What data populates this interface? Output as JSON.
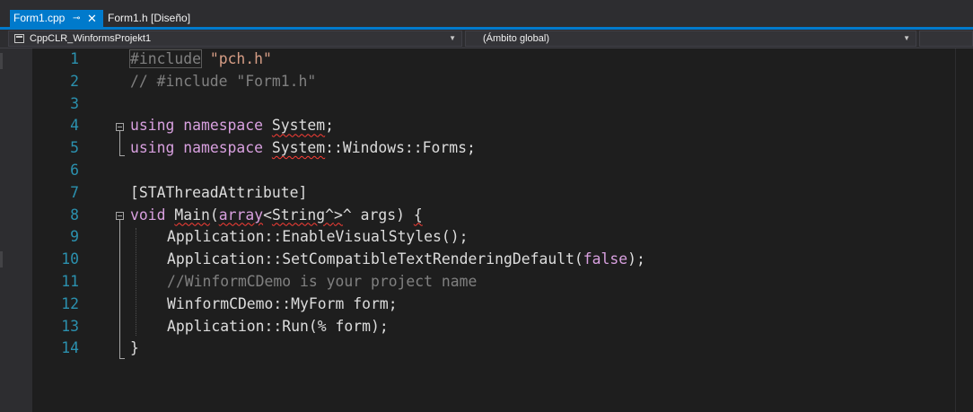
{
  "tabs": [
    {
      "label": "Form1.cpp",
      "pin_icon": "pin-icon",
      "close_icon": "close-icon",
      "active": true
    },
    {
      "label": "Form1.h [Diseño]",
      "active": false
    }
  ],
  "navbar": {
    "project": "CppCLR_WinformsProjekt1",
    "scope": "(Ámbito global)",
    "member": ""
  },
  "colors": {
    "accent": "#007acc",
    "background": "#1e1e1e",
    "line_number": "#2b91af",
    "keyword": "#569cd6",
    "string": "#d69d85",
    "comment": "#57a64a",
    "macro": "#d8a0df"
  },
  "line_numbers": [
    "1",
    "2",
    "3",
    "4",
    "5",
    "6",
    "7",
    "8",
    "9",
    "10",
    "11",
    "12",
    "13",
    "14"
  ],
  "code": {
    "l1_directive": "#include",
    "l1_string": "\"pch.h\"",
    "l2_comment": "// #include \"Form1.h\"",
    "l4_using": "using",
    "l4_namespace": "namespace",
    "l4_name": "System",
    "l4_semi": ";",
    "l5_using": "using",
    "l5_namespace": "namespace",
    "l5_name1": "System",
    "l5_rest": "::Windows::Forms;",
    "l7_attr": "[STAThreadAttribute]",
    "l8_void": "void",
    "l8_main": "Main",
    "l8_paren": "(",
    "l8_array": "array",
    "l8_lt": "<",
    "l8_string": "String^",
    "l8_gt": ">",
    "l8_hat": "^",
    "l8_args": " args) ",
    "l8_brace": "{",
    "l9": "Application::EnableVisualStyles();",
    "l10_a": "Application::SetCompatibleTextRenderingDefault(",
    "l10_false": "false",
    "l10_b": ");",
    "l11_comment": "//WinformCDemo is your project name",
    "l12": "WinformCDemo::MyForm form;",
    "l13": "Application::Run(% form);",
    "l14": "}"
  }
}
